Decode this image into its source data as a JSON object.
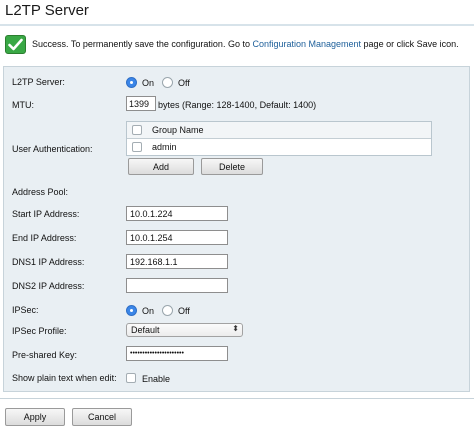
{
  "page": {
    "title": "L2TP Server"
  },
  "message": {
    "icon": "check-icon",
    "text_before": "Success. To permanently save the configuration. Go to ",
    "link": "Configuration Management",
    "text_after": " page or click Save icon."
  },
  "form": {
    "l2tp_server": {
      "label": "L2TP Server:",
      "on": "On",
      "off": "Off",
      "selected": "On"
    },
    "mtu": {
      "label": "MTU:",
      "value": "1399",
      "hint": "bytes (Range: 128-1400, Default: 1400)"
    },
    "user_auth": {
      "label": "User Authentication:",
      "column_header": "Group Name",
      "groups": [
        "admin"
      ],
      "add_label": "Add",
      "delete_label": "Delete"
    },
    "address_pool": {
      "label": "Address Pool:"
    },
    "start_ip": {
      "label": "Start IP Address:",
      "value": "10.0.1.224"
    },
    "end_ip": {
      "label": "End IP Address:",
      "value": "10.0.1.254"
    },
    "dns1": {
      "label": "DNS1 IP Address:",
      "value": "192.168.1.1"
    },
    "dns2": {
      "label": "DNS2 IP Address:",
      "value": ""
    },
    "ipsec": {
      "label": "IPSec:",
      "on": "On",
      "off": "Off",
      "selected": "On"
    },
    "ipsec_profile": {
      "label": "IPSec Profile:",
      "value": "Default"
    },
    "preshared_key": {
      "label": "Pre-shared Key:",
      "value": "••••••••••••••••••••••"
    },
    "show_plain": {
      "label": "Show plain text when edit:",
      "option": "Enable",
      "checked": false
    }
  },
  "footer": {
    "apply_label": "Apply",
    "cancel_label": "Cancel"
  },
  "colors": {
    "accent": "#3b86e8",
    "success": "#39a845",
    "link": "#1d5f9a",
    "panel": "#e9eff3"
  }
}
